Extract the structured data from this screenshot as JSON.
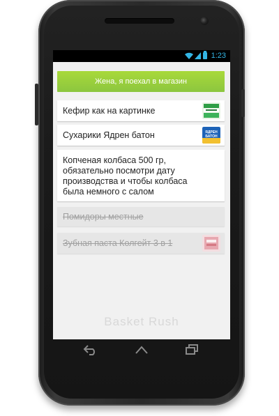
{
  "status_bar": {
    "time": "1:23",
    "icons": [
      "wifi-icon",
      "signal-icon",
      "battery-icon"
    ],
    "accent": "#33b5e5"
  },
  "header": {
    "title": "Жена, я поехал в магазин",
    "color": "#8cc63f"
  },
  "items": [
    {
      "label": "Кефир как на картинке",
      "done": false,
      "thumbnail": "kefir-package-image"
    },
    {
      "label": "Сухарики Ядрен батон",
      "done": false,
      "thumbnail": "crackers-package-image",
      "thumb_text": "ЯДРЕН БАТОН"
    },
    {
      "lines": [
        "Копченая колбаса 500 гр,",
        "обязательно посмотри дату",
        "производства и чтобы колбаса",
        "была немного с салом"
      ],
      "done": false
    },
    {
      "label": "Помидоры местные",
      "done": true
    },
    {
      "label": "Зубная паста Колгейт 3 в 1",
      "done": true,
      "thumbnail": "toothpaste-package-image"
    }
  ],
  "watermark": "Basket Rush",
  "nav": [
    "back-icon",
    "home-icon",
    "recent-apps-icon"
  ]
}
